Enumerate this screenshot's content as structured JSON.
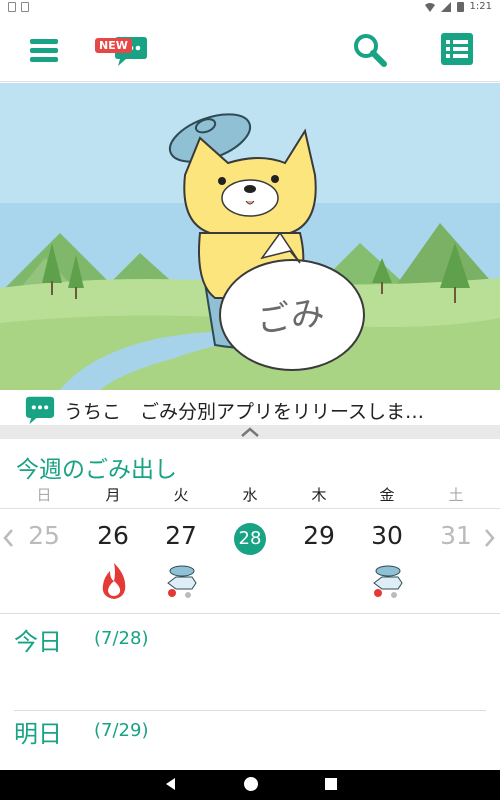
{
  "status_bar": {
    "time": "1:21"
  },
  "toolbar": {
    "new_badge": "NEW"
  },
  "hero": {
    "bag_label": "ごみ"
  },
  "news": {
    "text": "うちこ　ごみ分別アプリをリリースしま…"
  },
  "section_title": "今週のごみ出し",
  "weekdays": [
    "日",
    "月",
    "火",
    "水",
    "木",
    "金",
    "土"
  ],
  "dates": [
    "25",
    "26",
    "27",
    "28",
    "29",
    "30",
    "31"
  ],
  "today_index": 3,
  "garbage_icons": {
    "1": "fire-icon",
    "2": "recycle-icon",
    "5": "recycle-icon"
  },
  "today": {
    "label": "今日",
    "date": "(7/28)"
  },
  "tomorrow": {
    "label": "明日",
    "date": "(7/29)"
  },
  "colors": {
    "accent": "#18a384",
    "fire": "#e53935",
    "sky": "#9fcfe6"
  }
}
